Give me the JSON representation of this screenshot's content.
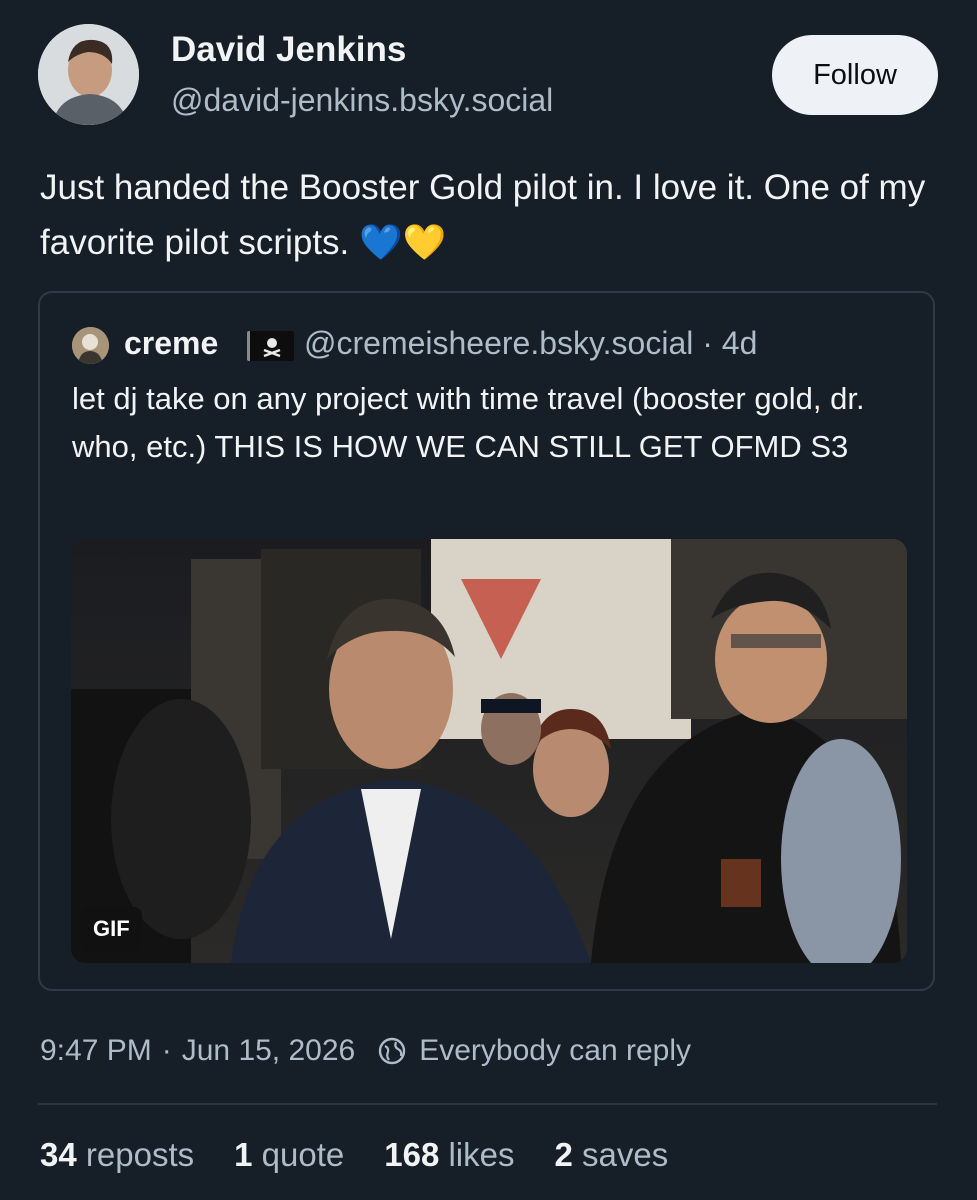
{
  "author": {
    "name": "David Jenkins",
    "handle": "@david-jenkins.bsky.social"
  },
  "follow_label": "Follow",
  "post_text": "Just handed the Booster Gold pilot in. I love it. One of my favorite pilot scripts. 💙💛",
  "quote": {
    "name": "creme",
    "flag_icon": "pirate-flag-icon",
    "handle_time": "@cremeisheere.bsky.social · 4d",
    "text": "let dj take on any project with time travel (booster gold, dr. who, etc.) THIS IS HOW WE CAN STILL GET OFMD S3",
    "media_badge": "GIF"
  },
  "meta": {
    "time": "9:47 PM",
    "date": "Jun 15, 2026",
    "reply_setting": "Everybody can reply"
  },
  "stats": {
    "reposts_count": "34",
    "reposts_label": "reposts",
    "quotes_count": "1",
    "quotes_label": "quote",
    "likes_count": "168",
    "likes_label": "likes",
    "saves_count": "2",
    "saves_label": "saves"
  }
}
